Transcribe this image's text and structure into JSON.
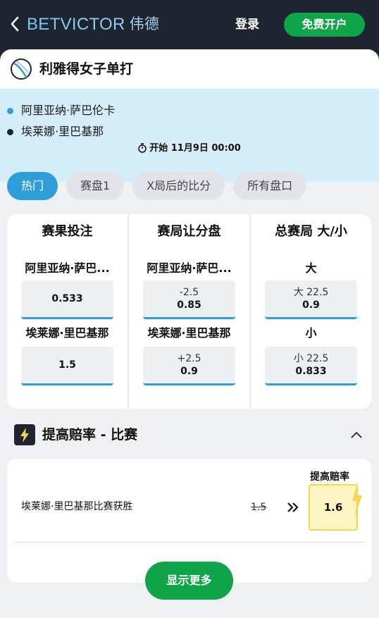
{
  "header": {
    "brand_bet": "BET",
    "brand_victor": "VICTOR",
    "brand_cn": "伟德",
    "login": "登录",
    "register": "免费开户"
  },
  "event": {
    "title": "利雅得女子单打",
    "players": [
      "阿里亚纳·萨巴伦卡",
      "埃莱娜·里巴基那"
    ],
    "start": "开始 11月9日 00:00"
  },
  "tabs": [
    {
      "label": "热门",
      "active": true
    },
    {
      "label": "赛盘1",
      "active": false
    },
    {
      "label": "X局后的比分",
      "active": false
    },
    {
      "label": "所有盘口",
      "active": false
    }
  ],
  "markets": [
    {
      "title": "赛果投注",
      "selections": [
        {
          "label": "阿里亚纳·萨巴...",
          "line": "",
          "price": "0.533"
        },
        {
          "label": "埃莱娜·里巴基那",
          "line": "",
          "price": "1.5"
        }
      ]
    },
    {
      "title": "赛局让分盘",
      "selections": [
        {
          "label": "阿里亚纳·萨巴...",
          "line": "-2.5",
          "price": "0.85"
        },
        {
          "label": "埃莱娜·里巴基那",
          "line": "+2.5",
          "price": "0.9"
        }
      ]
    },
    {
      "title": "总赛局 大/小",
      "selections": [
        {
          "label": "大",
          "line": "大 22.5",
          "price": "0.9"
        },
        {
          "label": "小",
          "line": "小 22.5",
          "price": "0.833"
        }
      ]
    }
  ],
  "boost": {
    "title": "提高赔率 - 比赛",
    "header": "提高赔率",
    "selection": "埃莱娜·里巴基那比赛获胜",
    "old_price": "1.5",
    "new_price": "1.6",
    "show_more": "显示更多"
  },
  "colors": {
    "header_bg": "#1e2530",
    "brand_blue": "#7fc4e9",
    "green": "#10a548",
    "accent_blue": "#2f9ed8",
    "event_bg": "#d5ecf9",
    "boost_yellow": "#f4d74b"
  }
}
